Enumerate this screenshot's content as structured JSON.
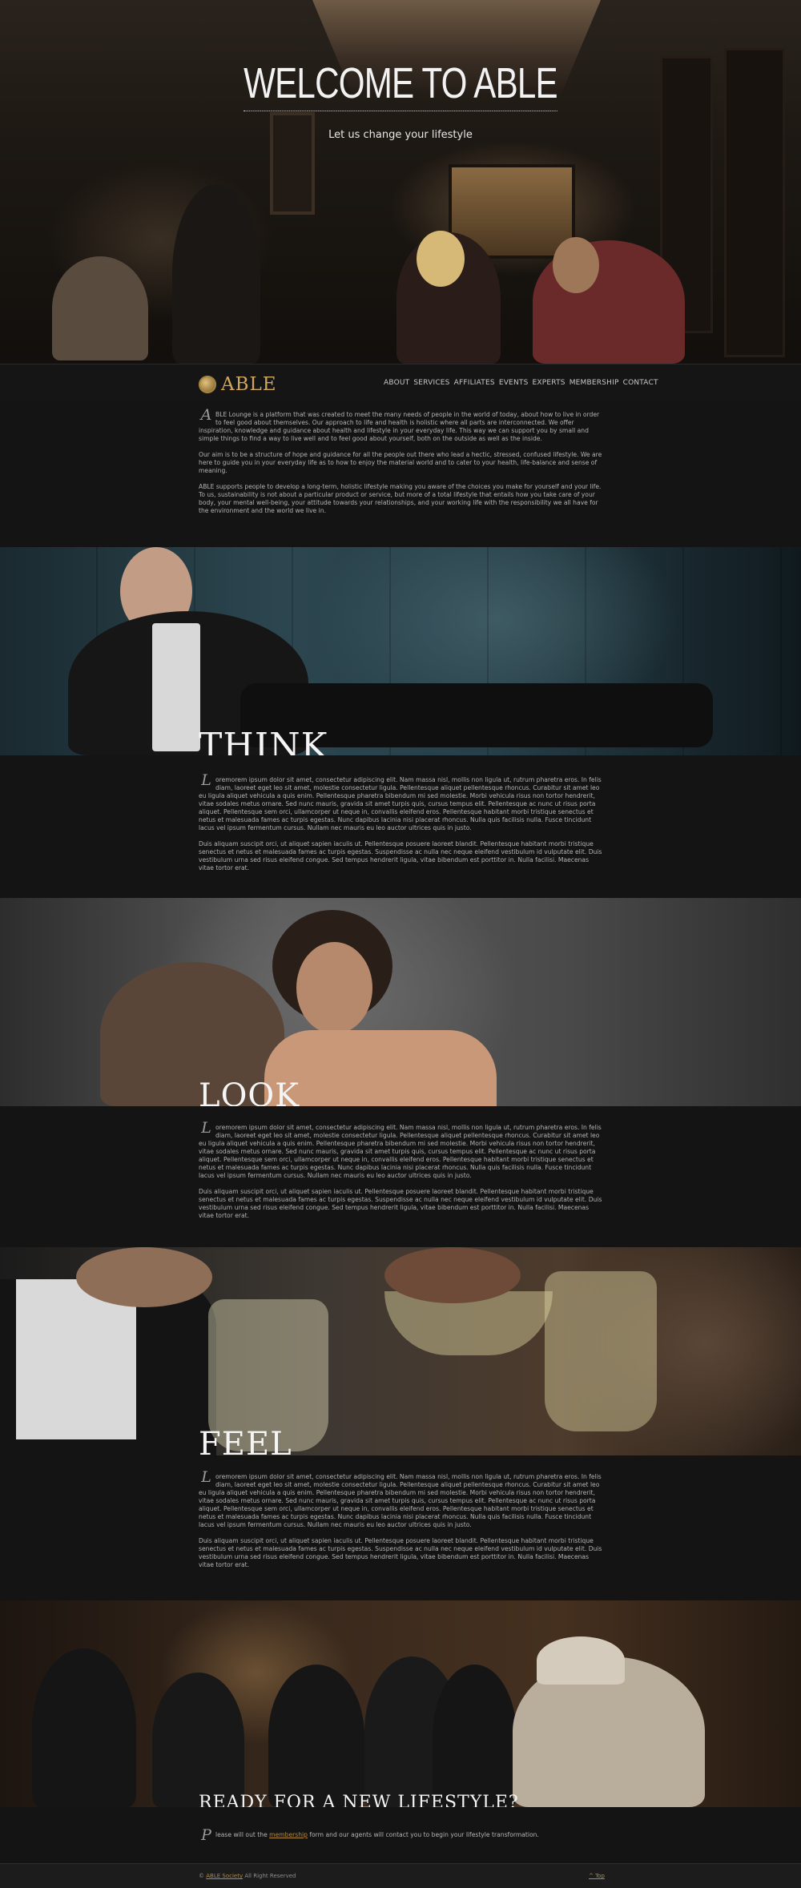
{
  "hero": {
    "title": "WELCOME TO ABLE",
    "subtitle": "Let us change your lifestyle"
  },
  "header": {
    "logo_text": "ABLE",
    "nav": [
      "ABOUT",
      "SERVICES",
      "AFFILIATES",
      "EVENTS",
      "EXPERTS",
      "MEMBERSHIP",
      "CONTACT"
    ]
  },
  "about": {
    "dropcap": "A",
    "paragraphs": [
      "BLE Lounge is a platform that was created to meet the many needs of people in the world of today, about how to live in order to feel good about themselves. Our approach to life and health is holistic where all parts are interconnected. We offer inspiration, knowledge and guidance about health and lifestyle in your everyday life. This way we can support you by small and simple things to find a way to live well and to feel good about yourself, both on the outside as well as the inside.",
      "Our aim is to be a structure of hope and guidance for all the people out there who lead a hectic, stressed, confused lifestyle. We are here to guide you in your everyday life as to how to enjoy the material world and to cater to your health, life-balance and sense of meaning.",
      "ABLE supports people to develop a long-term, holistic lifestyle making you aware of the choices you make for yourself and your life. To us, sustainability is not about a particular product or service, but more of a total lifestyle that entails how you take care of your body, your mental well-being, your attitude towards your relationships, and your working life with the responsibility we all have for the environment and the world we live in."
    ]
  },
  "sections": [
    {
      "title": "THINK",
      "dropcap": "L",
      "paragraphs": [
        "oremorem ipsum dolor sit amet, consectetur adipiscing elit. Nam massa nisl, mollis non ligula ut, rutrum pharetra eros. In felis diam, laoreet eget leo sit amet, molestie consectetur ligula. Pellentesque aliquet pellentesque rhoncus. Curabitur sit amet leo eu ligula aliquet vehicula a quis enim. Pellentesque pharetra bibendum mi sed molestie. Morbi vehicula risus non tortor hendrerit, vitae sodales metus ornare. Sed nunc mauris, gravida sit amet turpis quis, cursus tempus elit. Pellentesque ac nunc ut risus porta aliquet. Pellentesque sem orci, ullamcorper ut neque in, convallis eleifend eros. Pellentesque habitant morbi tristique senectus et netus et malesuada fames ac turpis egestas. Nunc dapibus lacinia nisi placerat rhoncus. Nulla quis facilisis nulla. Fusce tincidunt lacus vel ipsum fermentum cursus. Nullam nec mauris eu leo auctor ultrices quis in justo.",
        "Duis aliquam suscipit orci, ut aliquet sapien iaculis ut. Pellentesque posuere laoreet blandit. Pellentesque habitant morbi tristique senectus et netus et malesuada fames ac turpis egestas. Suspendisse ac nulla nec neque eleifend vestibulum id vulputate elit. Duis vestibulum urna sed risus eleifend congue. Sed tempus hendrerit ligula, vitae bibendum est porttitor in. Nulla facilisi. Maecenas vitae tortor erat."
      ]
    },
    {
      "title": "LOOK",
      "dropcap": "L",
      "paragraphs": [
        "oremorem ipsum dolor sit amet, consectetur adipiscing elit. Nam massa nisl, mollis non ligula ut, rutrum pharetra eros. In felis diam, laoreet eget leo sit amet, molestie consectetur ligula. Pellentesque aliquet pellentesque rhoncus. Curabitur sit amet leo eu ligula aliquet vehicula a quis enim. Pellentesque pharetra bibendum mi sed molestie. Morbi vehicula risus non tortor hendrerit, vitae sodales metus ornare. Sed nunc mauris, gravida sit amet turpis quis, cursus tempus elit. Pellentesque ac nunc ut risus porta aliquet. Pellentesque sem orci, ullamcorper ut neque in, convallis eleifend eros. Pellentesque habitant morbi tristique senectus et netus et malesuada fames ac turpis egestas. Nunc dapibus lacinia nisi placerat rhoncus. Nulla quis facilisis nulla. Fusce tincidunt lacus vel ipsum fermentum cursus. Nullam nec mauris eu leo auctor ultrices quis in justo.",
        "Duis aliquam suscipit orci, ut aliquet sapien iaculis ut. Pellentesque posuere laoreet blandit. Pellentesque habitant morbi tristique senectus et netus et malesuada fames ac turpis egestas. Suspendisse ac nulla nec neque eleifend vestibulum id vulputate elit. Duis vestibulum urna sed risus eleifend congue. Sed tempus hendrerit ligula, vitae bibendum est porttitor in. Nulla facilisi. Maecenas vitae tortor erat."
      ]
    },
    {
      "title": "FEEL",
      "dropcap": "L",
      "paragraphs": [
        "oremorem ipsum dolor sit amet, consectetur adipiscing elit. Nam massa nisl, mollis non ligula ut, rutrum pharetra eros. In felis diam, laoreet eget leo sit amet, molestie consectetur ligula. Pellentesque aliquet pellentesque rhoncus. Curabitur sit amet leo eu ligula aliquet vehicula a quis enim. Pellentesque pharetra bibendum mi sed molestie. Morbi vehicula risus non tortor hendrerit, vitae sodales metus ornare. Sed nunc mauris, gravida sit amet turpis quis, cursus tempus elit. Pellentesque ac nunc ut risus porta aliquet. Pellentesque sem orci, ullamcorper ut neque in, convallis eleifend eros. Pellentesque habitant morbi tristique senectus et netus et malesuada fames ac turpis egestas. Nunc dapibus lacinia nisi placerat rhoncus. Nulla quis facilisis nulla. Fusce tincidunt lacus vel ipsum fermentum cursus. Nullam nec mauris eu leo auctor ultrices quis in justo.",
        "Duis aliquam suscipit orci, ut aliquet sapien iaculis ut. Pellentesque posuere laoreet blandit. Pellentesque habitant morbi tristique senectus et netus et malesuada fames ac turpis egestas. Suspendisse ac nulla nec neque eleifend vestibulum id vulputate elit. Duis vestibulum urna sed risus eleifend congue. Sed tempus hendrerit ligula, vitae bibendum est porttitor in. Nulla facilisi. Maecenas vitae tortor erat."
      ]
    }
  ],
  "cta": {
    "title": "READY FOR A NEW LIFESTYLE?",
    "dropcap": "P",
    "text_before": "lease will out the ",
    "link_text": "membership",
    "text_after": " form and our agents will contact you to begin your lifestyle transformation."
  },
  "footer": {
    "copyright_symbol": "©",
    "brand": "ABLE Society",
    "rights": "All Right Reserved",
    "top_link": "^ Top"
  },
  "colors": {
    "accent": "#b58a3d",
    "logo": "#cfa65b",
    "background": "#141414"
  },
  "icons": {
    "logo_mark": "gold-medallion-icon",
    "dropcap_ornament": "ornate-initial-icon"
  }
}
